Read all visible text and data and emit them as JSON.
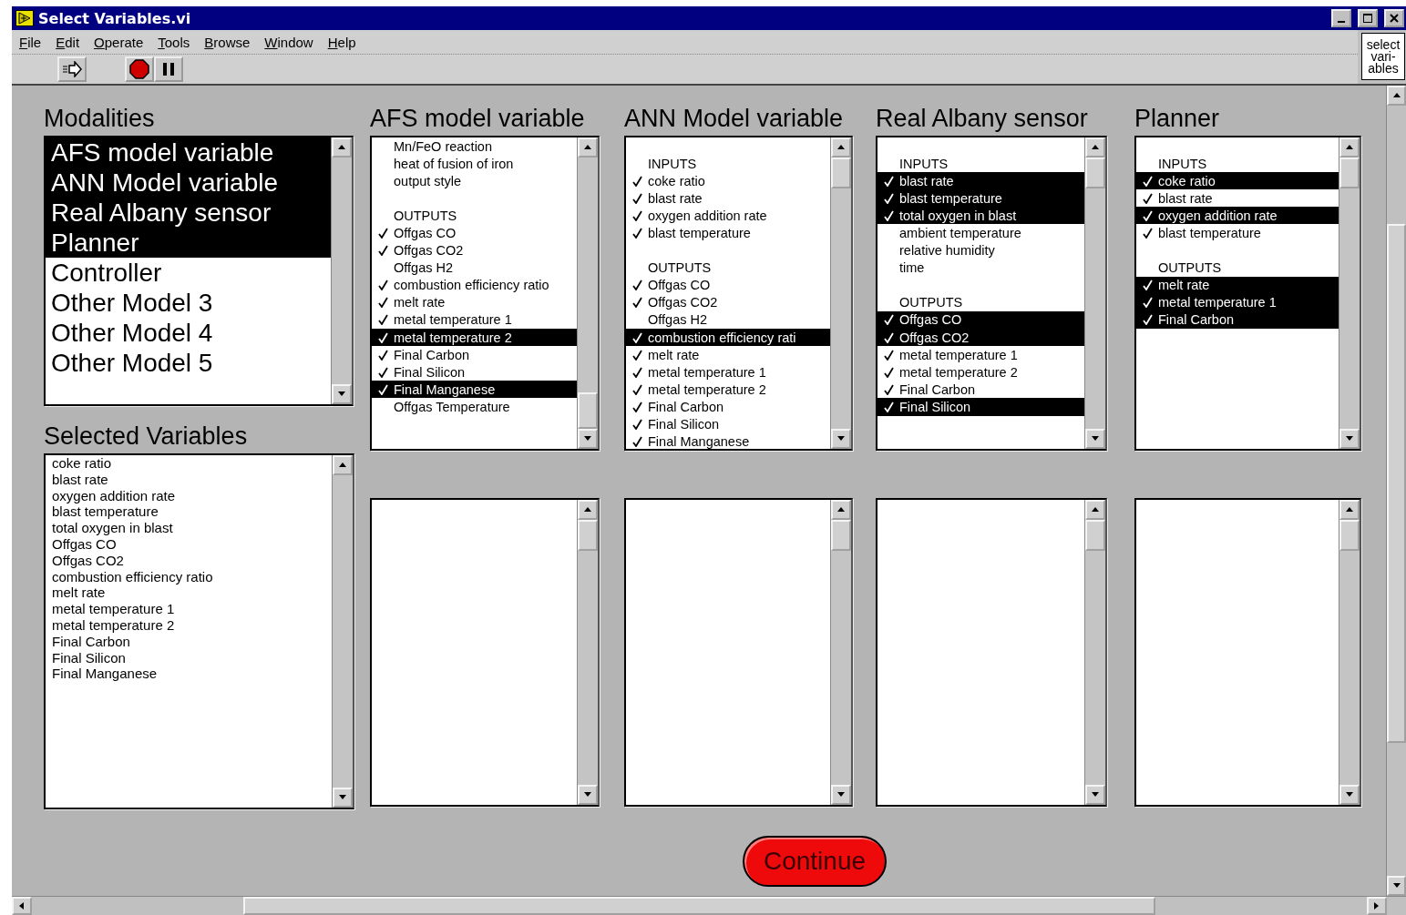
{
  "window": {
    "title": "Select Variables.vi"
  },
  "menu": [
    "File",
    "Edit",
    "Operate",
    "Tools",
    "Browse",
    "Window",
    "Help"
  ],
  "vi_icon": {
    "lines": [
      "select",
      "vari-",
      "ables"
    ]
  },
  "modalities": {
    "label": "Modalities",
    "items": [
      {
        "text": "AFS model variable",
        "selected": true
      },
      {
        "text": "ANN Model variable",
        "selected": true
      },
      {
        "text": "Real Albany sensor",
        "selected": true
      },
      {
        "text": "Planner",
        "selected": true
      },
      {
        "text": "Controller",
        "selected": false
      },
      {
        "text": "Other Model 3",
        "selected": false
      },
      {
        "text": "Other Model 4",
        "selected": false
      },
      {
        "text": "Other Model 5",
        "selected": false
      }
    ]
  },
  "selected_variables": {
    "label": "Selected Variables",
    "items": [
      "coke ratio",
      "blast rate",
      "oxygen addition rate",
      "blast temperature",
      "total oxygen in blast",
      "Offgas CO",
      "Offgas CO2",
      "combustion efficiency ratio",
      "melt rate",
      "metal temperature 1",
      "metal temperature 2",
      "Final Carbon",
      "Final Silicon",
      "Final Manganese"
    ]
  },
  "panels": [
    {
      "label": "AFS model variable",
      "items": [
        {
          "kind": "variable",
          "text": "Mn/FeO reaction",
          "checked": false,
          "selected": false
        },
        {
          "kind": "variable",
          "text": "heat of fusion of iron",
          "checked": false,
          "selected": false
        },
        {
          "kind": "variable",
          "text": "output style",
          "checked": false,
          "selected": false
        },
        {
          "kind": "spacer",
          "checked": false,
          "selected": false
        },
        {
          "kind": "heading",
          "text": "OUTPUTS",
          "checked": false,
          "selected": false
        },
        {
          "kind": "variable",
          "text": "Offgas CO",
          "checked": true,
          "selected": false
        },
        {
          "kind": "variable",
          "text": "Offgas CO2",
          "checked": true,
          "selected": false
        },
        {
          "kind": "variable",
          "text": "Offgas H2",
          "checked": false,
          "selected": false
        },
        {
          "kind": "variable",
          "text": "combustion efficiency ratio",
          "checked": true,
          "selected": false
        },
        {
          "kind": "variable",
          "text": "melt rate",
          "checked": true,
          "selected": false
        },
        {
          "kind": "variable",
          "text": "metal temperature 1",
          "checked": true,
          "selected": false
        },
        {
          "kind": "variable",
          "text": "metal temperature 2",
          "checked": true,
          "selected": true
        },
        {
          "kind": "variable",
          "text": "Final Carbon",
          "checked": true,
          "selected": false
        },
        {
          "kind": "variable",
          "text": "Final Silicon",
          "checked": true,
          "selected": false
        },
        {
          "kind": "variable",
          "text": "Final Manganese",
          "checked": true,
          "selected": true
        },
        {
          "kind": "variable",
          "text": "Offgas Temperature",
          "checked": false,
          "selected": false
        }
      ]
    },
    {
      "label": "ANN Model variable",
      "items": [
        {
          "kind": "spacer",
          "checked": false,
          "selected": false
        },
        {
          "kind": "heading",
          "text": "INPUTS",
          "checked": false,
          "selected": false
        },
        {
          "kind": "variable",
          "text": "coke ratio",
          "checked": true,
          "selected": false
        },
        {
          "kind": "variable",
          "text": "blast rate",
          "checked": true,
          "selected": false
        },
        {
          "kind": "variable",
          "text": "oxygen addition rate",
          "checked": true,
          "selected": false
        },
        {
          "kind": "variable",
          "text": "blast temperature",
          "checked": true,
          "selected": false
        },
        {
          "kind": "spacer",
          "checked": false,
          "selected": false
        },
        {
          "kind": "heading",
          "text": "OUTPUTS",
          "checked": false,
          "selected": false
        },
        {
          "kind": "variable",
          "text": "Offgas CO",
          "checked": true,
          "selected": false
        },
        {
          "kind": "variable",
          "text": "Offgas CO2",
          "checked": true,
          "selected": false
        },
        {
          "kind": "variable",
          "text": "Offgas H2",
          "checked": false,
          "selected": false
        },
        {
          "kind": "variable",
          "text": "combustion efficiency rati",
          "checked": true,
          "selected": true
        },
        {
          "kind": "variable",
          "text": "melt rate",
          "checked": true,
          "selected": false
        },
        {
          "kind": "variable",
          "text": "metal temperature 1",
          "checked": true,
          "selected": false
        },
        {
          "kind": "variable",
          "text": "metal temperature 2",
          "checked": true,
          "selected": false
        },
        {
          "kind": "variable",
          "text": "Final Carbon",
          "checked": true,
          "selected": false
        },
        {
          "kind": "variable",
          "text": "Final Silicon",
          "checked": true,
          "selected": false
        },
        {
          "kind": "variable",
          "text": "Final Manganese",
          "checked": true,
          "selected": false
        }
      ]
    },
    {
      "label": "Real Albany sensor",
      "items": [
        {
          "kind": "spacer",
          "checked": false,
          "selected": false
        },
        {
          "kind": "heading",
          "text": "INPUTS",
          "checked": false,
          "selected": false
        },
        {
          "kind": "variable",
          "text": "blast rate",
          "checked": true,
          "selected": true
        },
        {
          "kind": "variable",
          "text": "blast temperature",
          "checked": true,
          "selected": true
        },
        {
          "kind": "variable",
          "text": "total oxygen in blast",
          "checked": true,
          "selected": true
        },
        {
          "kind": "variable",
          "text": "ambient temperature",
          "checked": false,
          "selected": false
        },
        {
          "kind": "variable",
          "text": "relative humidity",
          "checked": false,
          "selected": false
        },
        {
          "kind": "variable",
          "text": "time",
          "checked": false,
          "selected": false
        },
        {
          "kind": "spacer",
          "checked": false,
          "selected": false
        },
        {
          "kind": "heading",
          "text": "OUTPUTS",
          "checked": false,
          "selected": false
        },
        {
          "kind": "variable",
          "text": "Offgas CO",
          "checked": true,
          "selected": true
        },
        {
          "kind": "variable",
          "text": "Offgas CO2",
          "checked": true,
          "selected": true
        },
        {
          "kind": "variable",
          "text": "metal temperature 1",
          "checked": true,
          "selected": false
        },
        {
          "kind": "variable",
          "text": "metal temperature 2",
          "checked": true,
          "selected": false
        },
        {
          "kind": "variable",
          "text": "Final Carbon",
          "checked": true,
          "selected": false
        },
        {
          "kind": "variable",
          "text": "Final Silicon",
          "checked": true,
          "selected": true
        }
      ]
    },
    {
      "label": "Planner",
      "items": [
        {
          "kind": "spacer",
          "checked": false,
          "selected": false
        },
        {
          "kind": "heading",
          "text": "INPUTS",
          "checked": false,
          "selected": false
        },
        {
          "kind": "variable",
          "text": "coke ratio",
          "checked": true,
          "selected": true
        },
        {
          "kind": "variable",
          "text": "blast rate",
          "checked": true,
          "selected": false
        },
        {
          "kind": "variable",
          "text": "oxygen addition rate",
          "checked": true,
          "selected": true
        },
        {
          "kind": "variable",
          "text": "blast temperature",
          "checked": true,
          "selected": false
        },
        {
          "kind": "spacer",
          "checked": false,
          "selected": false
        },
        {
          "kind": "heading",
          "text": "OUTPUTS",
          "checked": false,
          "selected": false
        },
        {
          "kind": "variable",
          "text": "melt rate",
          "checked": true,
          "selected": true
        },
        {
          "kind": "variable",
          "text": "metal temperature 1",
          "checked": true,
          "selected": true
        },
        {
          "kind": "variable",
          "text": "Final Carbon",
          "checked": true,
          "selected": true
        }
      ]
    }
  ],
  "continue_button": "Continue"
}
